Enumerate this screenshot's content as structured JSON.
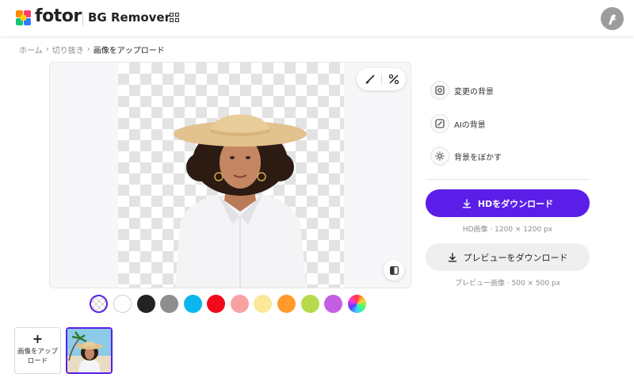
{
  "header": {
    "brand": "fotor",
    "product": "BG Remover",
    "icons": {
      "logo": "fotor-logo-icon",
      "apps": "apps-grid-icon",
      "avatar": "user-avatar-icon"
    }
  },
  "breadcrumb": [
    "ホーム",
    "切り抜き",
    "画像をアップロード"
  ],
  "preview": {
    "tools": [
      "brush-icon",
      "erase-icon"
    ],
    "compare": "compare-icon"
  },
  "swatches": [
    {
      "name": "transparent",
      "color": "transparent",
      "selected": true
    },
    {
      "name": "white",
      "color": "#ffffff"
    },
    {
      "name": "black",
      "color": "#222222"
    },
    {
      "name": "gray",
      "color": "#8e8e8e"
    },
    {
      "name": "sky-blue",
      "color": "#0bb6ee"
    },
    {
      "name": "red",
      "color": "#f2091c"
    },
    {
      "name": "pink",
      "color": "#f7a2a2"
    },
    {
      "name": "light-yellow",
      "color": "#fbe898"
    },
    {
      "name": "orange",
      "color": "#ff9a2b"
    },
    {
      "name": "lime",
      "color": "#b7d94c"
    },
    {
      "name": "purple",
      "color": "#c35fe0"
    },
    {
      "name": "multicolor",
      "color": "gradient"
    }
  ],
  "options": [
    {
      "label": "変更の背景",
      "icon": "change-background-icon"
    },
    {
      "label": "AIの背景",
      "icon": "ai-background-icon"
    },
    {
      "label": "背景をぼかす",
      "icon": "blur-background-icon"
    }
  ],
  "downloads": {
    "hd_label": "HDをダウンロード",
    "hd_meta": "HD画像 · 1200 × 1200 px",
    "preview_label": "プレビューをダウンロード",
    "preview_meta": "プレビュー画像 · 500 × 500 px"
  },
  "upload": {
    "plus": "+",
    "label": "画像をアップロード"
  },
  "colors": {
    "accent": "#5a1ee8"
  }
}
